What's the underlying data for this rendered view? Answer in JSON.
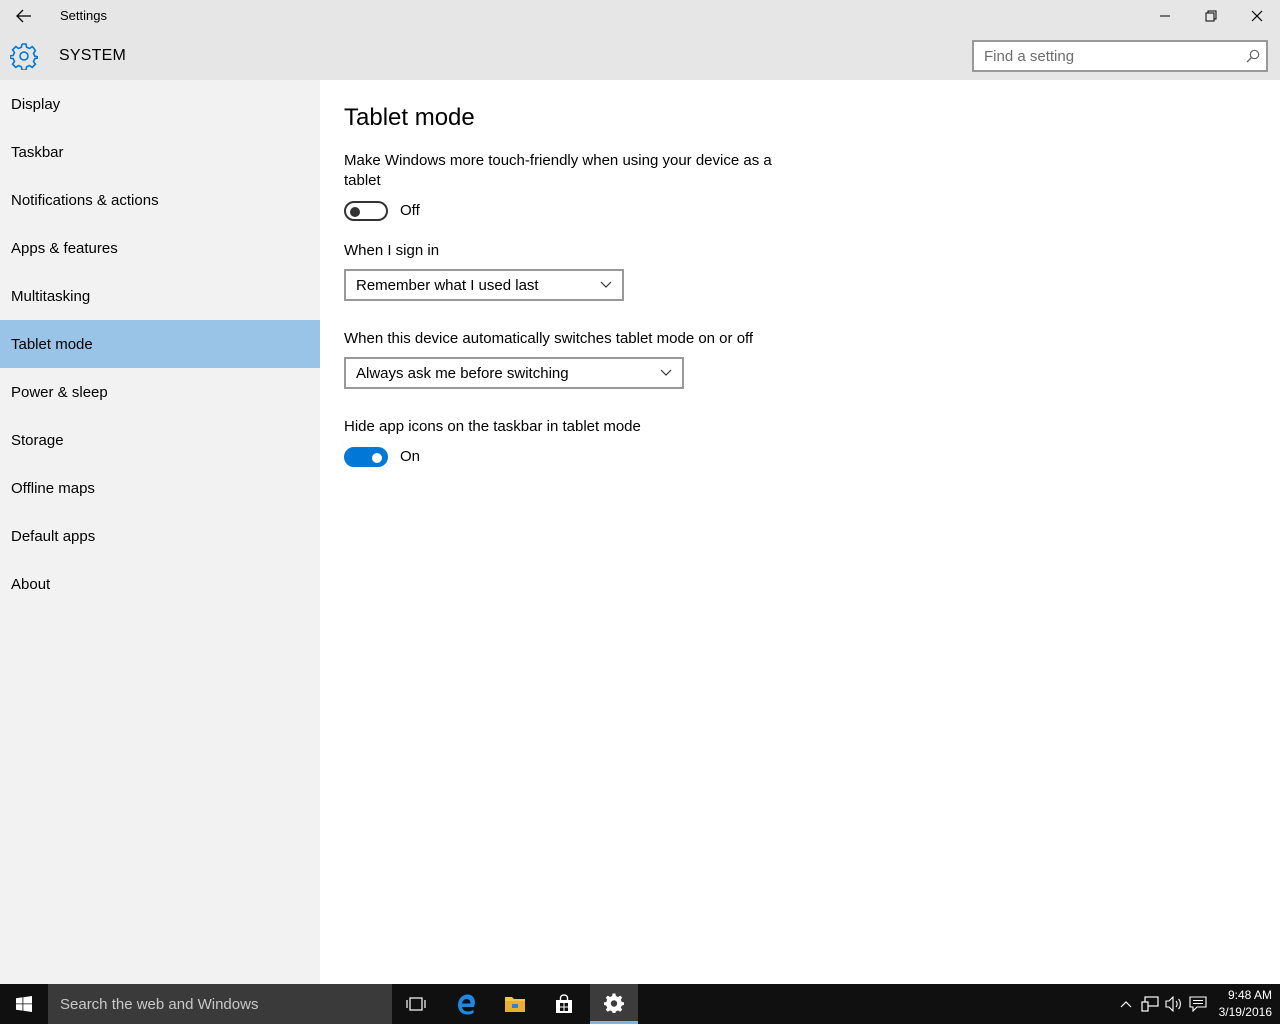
{
  "window": {
    "title": "Settings"
  },
  "header": {
    "title": "SYSTEM",
    "search_placeholder": "Find a setting"
  },
  "sidebar": {
    "items": [
      {
        "label": "Display"
      },
      {
        "label": "Taskbar"
      },
      {
        "label": "Notifications & actions"
      },
      {
        "label": "Apps & features"
      },
      {
        "label": "Multitasking"
      },
      {
        "label": "Tablet mode",
        "active": true
      },
      {
        "label": "Power & sleep"
      },
      {
        "label": "Storage"
      },
      {
        "label": "Offline maps"
      },
      {
        "label": "Default apps"
      },
      {
        "label": "About"
      }
    ]
  },
  "main": {
    "title": "Tablet mode",
    "touch_label": "Make Windows more touch-friendly when using your device as a tablet",
    "touch_toggle_state": "Off",
    "signin_label": "When I sign in",
    "signin_value": "Remember what I used last",
    "switch_label": "When this device automatically switches tablet mode on or off",
    "switch_value": "Always ask me before switching",
    "hide_icons_label": "Hide app icons on the taskbar in tablet mode",
    "hide_icons_toggle_state": "On"
  },
  "taskbar": {
    "search_placeholder": "Search the web and Windows",
    "time": "9:48 AM",
    "date": "3/19/2016"
  },
  "colors": {
    "accent": "#0078d7",
    "selected_nav": "#99c4e8",
    "sidebar_bg": "#f2f2f2",
    "taskbar_bg": "#101010"
  }
}
